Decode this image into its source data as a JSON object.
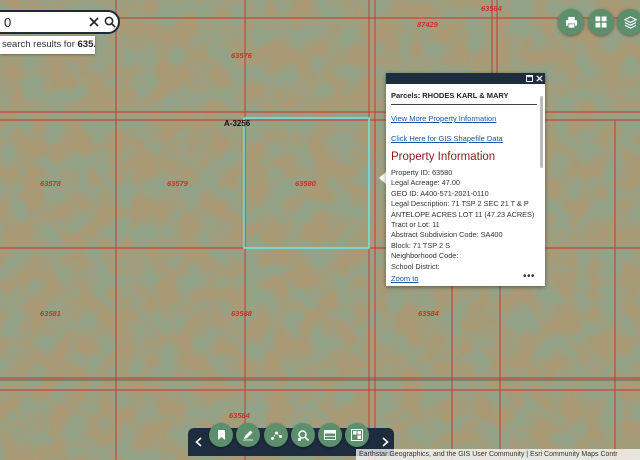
{
  "search": {
    "value": "0",
    "suggestion_prefix": "search results for ",
    "suggestion_term": "635..."
  },
  "map_labels": {
    "parcels": [
      "87429",
      "63584",
      "63576",
      "63578",
      "63579",
      "63580",
      "63581",
      "63588",
      "63584",
      "63584"
    ],
    "road_label": "A-3256"
  },
  "popup": {
    "title": "Parcels: RHODES KARL & MARY",
    "link_more": "View More Property Information",
    "link_gis": "Click Here for GIS Shapefile Data",
    "heading": "Property Information",
    "attributes": [
      "Property ID: 63580",
      "Legal Acreage: 47.00",
      "GEO ID: A400-571-2021-0110",
      "Legal Description: 71 TSP 2 SEC 21 T & P",
      "ANTELOPE ACRES LOT 11 (47.23 ACRES)",
      "Tract or Lot: 11",
      "Abstract Subdivision Code: SA400",
      "Block: 71 TSP 2 S",
      "Neighborhood Code:",
      "School District:"
    ],
    "zoom_to": "Zoom to",
    "more": "•••"
  },
  "attribution": "Earthstar Geographics, and the GIS User Community | Esri Community Maps Contr",
  "colors": {
    "accent_green": "#5c8f6c",
    "navy": "#1e2c40",
    "parcel_line": "#c8322e",
    "selection": "#6fe3e0",
    "link": "#1a55a0",
    "heading": "#8a1b1b"
  }
}
